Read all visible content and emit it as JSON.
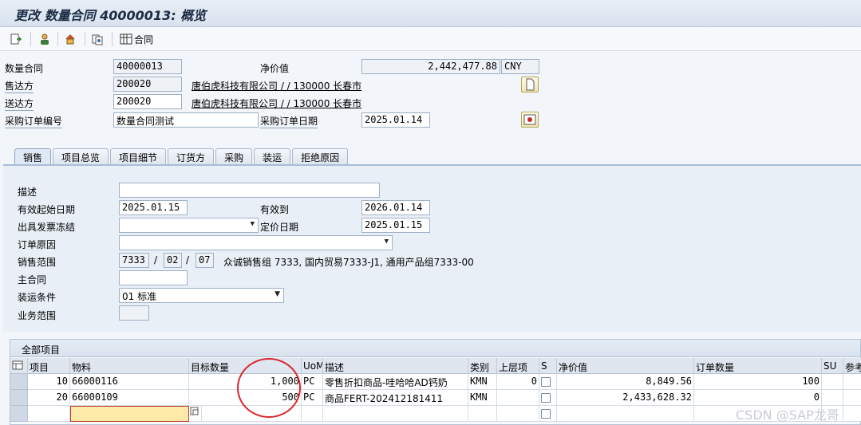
{
  "title": "更改 数量合同 40000013: 概览",
  "toolbar": {
    "contract_label": "合同",
    "icons": [
      "display-change-icon",
      "partner-icon",
      "header-icon",
      "document-flow-icon",
      "contract-grid-icon"
    ]
  },
  "header": {
    "contract_no_label": "数量合同",
    "contract_no": "40000013",
    "net_value_label": "净价值",
    "net_value": "2,442,477.88",
    "currency": "CNY",
    "sold_to_label": "售达方",
    "sold_to": "200020",
    "sold_to_desc": "唐伯虎科技有限公司 / / 130000 长春市",
    "ship_to_label": "送达方",
    "ship_to": "200020",
    "ship_to_desc": "唐伯虎科技有限公司 / / 130000 长春市",
    "po_no_label": "采购订单编号",
    "po_no": "数量合同测试",
    "po_date_label": "采购订单日期",
    "po_date": "2025.01.14"
  },
  "tabs": [
    "销售",
    "项目总览",
    "项目细节",
    "订货方",
    "采购",
    "装运",
    "拒绝原因"
  ],
  "sales": {
    "desc_label": "描述",
    "desc": "",
    "valid_from_label": "有效起始日期",
    "valid_from": "2025.01.15",
    "valid_to_label": "有效到",
    "valid_to": "2026.01.14",
    "billing_block_label": "出具发票冻结",
    "billing_block": "",
    "pricing_date_label": "定价日期",
    "pricing_date": "2025.01.15",
    "order_reason_label": "订单原因",
    "order_reason": "",
    "sales_area_label": "销售范围",
    "sales_org": "7333",
    "dist_channel": "02",
    "division": "07",
    "sales_area_desc": "众诚销售组 7333, 国内贸易7333-J1, 通用产品组7333-00",
    "master_contract_label": "主合同",
    "master_contract": "",
    "shipping_cond_label": "装运条件",
    "shipping_cond": "01 标准",
    "business_area_label": "业务范围",
    "business_area": ""
  },
  "items": {
    "caption": "全部项目",
    "columns": [
      "项目",
      "物料",
      "目标数量",
      "UoM",
      "描述",
      "类别",
      "上层项",
      "S",
      "净价值",
      "订单数量",
      "SU",
      "参考"
    ],
    "rows": [
      {
        "item": "10",
        "material": "66000116",
        "target_qty": "1,000",
        "uom": "PC",
        "desc": "零售折扣商品-哇哈哈AD钙奶",
        "category": "KMN",
        "higher_item": "0",
        "net_value": "8,849.56",
        "order_qty": "100"
      },
      {
        "item": "20",
        "material": "66000109",
        "target_qty": "500",
        "uom": "PC",
        "desc": "商品FERT-202412181411",
        "category": "KMN",
        "higher_item": "",
        "net_value": "2,433,628.32",
        "order_qty": "0"
      }
    ]
  },
  "watermark": "CSDN @SAP龙哥"
}
